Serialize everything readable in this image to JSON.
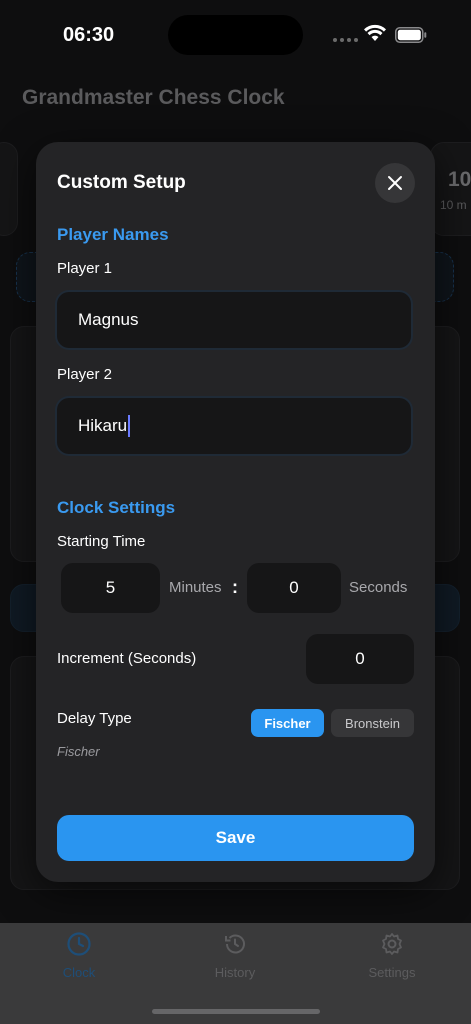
{
  "status_bar": {
    "time": "06:30"
  },
  "background": {
    "app_title": "Grandmaster Chess Clock",
    "preset_value": "10",
    "preset_sub": "10 m"
  },
  "modal": {
    "title": "Custom Setup",
    "player_section": {
      "title": "Player Names",
      "player1_label": "Player 1",
      "player1_value": "Magnus",
      "player2_label": "Player 2",
      "player2_value": "Hikaru"
    },
    "clock_section": {
      "title": "Clock Settings",
      "starting_time_label": "Starting Time",
      "minutes_value": "5",
      "minutes_unit": "Minutes",
      "separator": ":",
      "seconds_value": "0",
      "seconds_unit": "Seconds",
      "increment_label": "Increment (Seconds)",
      "increment_value": "0",
      "delay_label": "Delay Type",
      "delay_options": [
        "Fischer",
        "Bronstein"
      ],
      "delay_selected": "Fischer",
      "delay_description": "Fischer"
    },
    "save_label": "Save"
  },
  "tab_bar": {
    "tabs": [
      {
        "label": "Clock",
        "icon": "clock-icon",
        "active": true
      },
      {
        "label": "History",
        "icon": "history-icon",
        "active": false
      },
      {
        "label": "Settings",
        "icon": "gear-icon",
        "active": false
      }
    ]
  },
  "colors": {
    "accent": "#2a95f0",
    "modal_bg": "#242426",
    "field_bg": "#161617"
  }
}
